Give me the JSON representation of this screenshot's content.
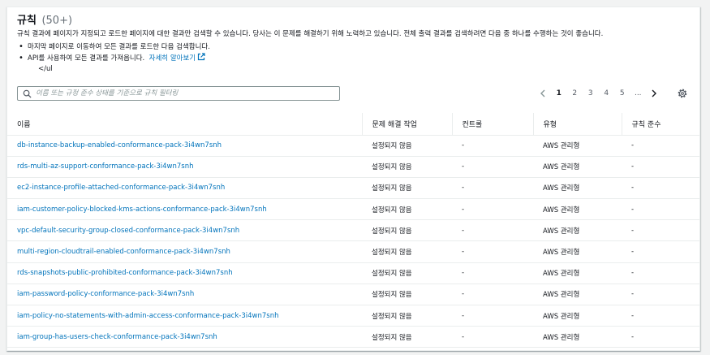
{
  "header": {
    "title": "규칙",
    "count": "(50+)",
    "description": "규칙 결과에 페이지가 지정되고 로드한 페이지에 대한 결과만 검색할 수 있습니다. 당사는 이 문제를 해결하기 위해 노력하고 있습니다. 전체 출력 결과를 검색하려면 다음 중 하나를 수행하는 것이 좋습니다.",
    "bullets": [
      "마지막 페이지로 이동하여 모든 결과를 로드한 다음 검색합니다.",
      "API를 사용하여 모든 결과를 가져옵니다."
    ],
    "learn_more": "자세히 알아보기",
    "tail": "</ul"
  },
  "search": {
    "placeholder": "이름 또는 규정 준수 상태를 기준으로 규칙 필터링",
    "value": ""
  },
  "pagination": {
    "pages": [
      "1",
      "2",
      "3",
      "4",
      "5",
      "..."
    ],
    "current": "1"
  },
  "table": {
    "columns": [
      "이름",
      "문제 해결 작업",
      "컨트롤",
      "유형",
      "규칙 준수"
    ],
    "rows": [
      {
        "name": "db-instance-backup-enabled-conformance-pack-3i4wn7snh",
        "remediation": "설정되지 않음",
        "control": "-",
        "type": "AWS 관리형",
        "compliance": "-"
      },
      {
        "name": "rds-multi-az-support-conformance-pack-3i4wn7snh",
        "remediation": "설정되지 않음",
        "control": "-",
        "type": "AWS 관리형",
        "compliance": "-"
      },
      {
        "name": "ec2-instance-profile-attached-conformance-pack-3i4wn7snh",
        "remediation": "설정되지 않음",
        "control": "-",
        "type": "AWS 관리형",
        "compliance": "-"
      },
      {
        "name": "iam-customer-policy-blocked-kms-actions-conformance-pack-3i4wn7snh",
        "remediation": "설정되지 않음",
        "control": "-",
        "type": "AWS 관리형",
        "compliance": "-"
      },
      {
        "name": "vpc-default-security-group-closed-conformance-pack-3i4wn7snh",
        "remediation": "설정되지 않음",
        "control": "-",
        "type": "AWS 관리형",
        "compliance": "-"
      },
      {
        "name": "multi-region-cloudtrail-enabled-conformance-pack-3i4wn7snh",
        "remediation": "설정되지 않음",
        "control": "-",
        "type": "AWS 관리형",
        "compliance": "-"
      },
      {
        "name": "rds-snapshots-public-prohibited-conformance-pack-3i4wn7snh",
        "remediation": "설정되지 않음",
        "control": "-",
        "type": "AWS 관리형",
        "compliance": "-"
      },
      {
        "name": "iam-password-policy-conformance-pack-3i4wn7snh",
        "remediation": "설정되지 않음",
        "control": "-",
        "type": "AWS 관리형",
        "compliance": "-"
      },
      {
        "name": "iam-policy-no-statements-with-admin-access-conformance-pack-3i4wn7snh",
        "remediation": "설정되지 않음",
        "control": "-",
        "type": "AWS 관리형",
        "compliance": "-"
      },
      {
        "name": "iam-group-has-users-check-conformance-pack-3i4wn7snh",
        "remediation": "설정되지 않음",
        "control": "-",
        "type": "AWS 관리형",
        "compliance": "-"
      }
    ]
  },
  "colors": {
    "link": "#0073bb",
    "text": "#16191f",
    "muted": "#687078",
    "border": "#eaeded",
    "background": "#f2f3f3"
  },
  "icons": [
    "search-icon",
    "external-link-icon",
    "chevron-left-icon",
    "chevron-right-icon",
    "settings-gear-icon"
  ]
}
